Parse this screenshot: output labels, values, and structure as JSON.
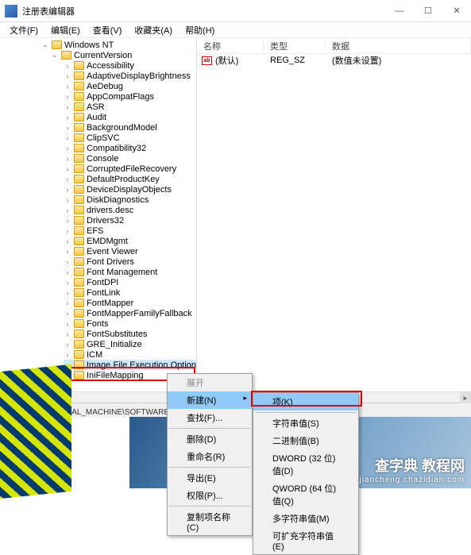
{
  "window": {
    "title": "注册表编辑器",
    "btn_min": "—",
    "btn_max": "☐",
    "btn_close": "✕"
  },
  "menubar": [
    "文件(F)",
    "编辑(E)",
    "查看(V)",
    "收藏夹(A)",
    "帮助(H)"
  ],
  "tree": {
    "root": "Windows NT",
    "currentversion": "CurrentVersion",
    "items": [
      "Accessibility",
      "AdaptiveDisplayBrightness",
      "AeDebug",
      "AppCompatFlags",
      "ASR",
      "Audit",
      "BackgroundModel",
      "ClipSVC",
      "Compatibility32",
      "Console",
      "CorruptedFileRecovery",
      "DefaultProductKey",
      "DeviceDisplayObjects",
      "DiskDiagnostics",
      "drivers.desc",
      "Drivers32",
      "EFS",
      "EMDMgmt",
      "Event Viewer",
      "Font Drivers",
      "Font Management",
      "FontDPI",
      "FontLink",
      "FontMapper",
      "FontMapperFamilyFallback",
      "Fonts",
      "FontSubstitutes",
      "GRE_Initialize",
      "ICM",
      "Image File Execution Option",
      "IniFileMapping"
    ],
    "selected_index": 29
  },
  "list": {
    "cols": [
      "名称",
      "类型",
      "数据"
    ],
    "row": {
      "name": "(默认)",
      "type": "REG_SZ",
      "data": "(数值未设置)"
    }
  },
  "statusbar": "计算机\\HKEY_LOCAL_MACHINE\\SOFTWARE\\Micro",
  "context1": {
    "expand": "展开",
    "new": "新建(N)",
    "find": "查找(F)...",
    "delete": "删除(D)",
    "rename": "重命名(R)",
    "export": "导出(E)",
    "perm": "权限(P)...",
    "copyname": "复制项名称(C)"
  },
  "context2": [
    "项(K)",
    "字符串值(S)",
    "二进制值(B)",
    "DWORD (32 位)值(D)",
    "QWORD (64 位)值(Q)",
    "多字符串值(M)",
    "可扩充字符串值(E)"
  ],
  "watermark": {
    "big": "查字典 教程网",
    "small": "jiaocheng.chazidian.com"
  }
}
